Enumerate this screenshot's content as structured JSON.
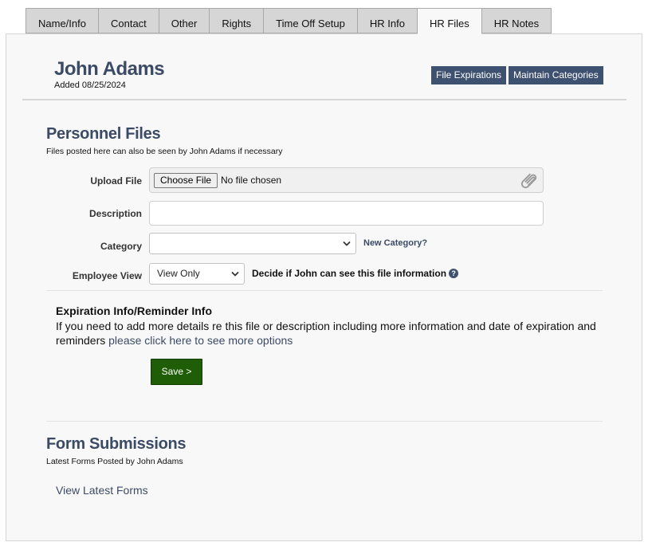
{
  "tabs": [
    {
      "label": "Name/Info"
    },
    {
      "label": "Contact"
    },
    {
      "label": "Other"
    },
    {
      "label": "Rights"
    },
    {
      "label": "Time Off Setup"
    },
    {
      "label": "HR Info"
    },
    {
      "label": "HR Files",
      "active": true
    },
    {
      "label": "HR Notes"
    }
  ],
  "employee": {
    "name": "John Adams",
    "added": "Added 08/25/2024"
  },
  "toolbar": {
    "file_expirations": "File Expirations",
    "maintain_categories": "Maintain Categories"
  },
  "personnel_files": {
    "title": "Personnel Files",
    "note": "Files posted here can also be seen by John Adams if necessary",
    "upload_label": "Upload File",
    "choose_file": "Choose File",
    "no_file": "No file chosen",
    "description_label": "Description",
    "description_value": "",
    "category_label": "Category",
    "category_value": "",
    "new_category": "New Category?",
    "employee_view_label": "Employee View",
    "employee_view_value": "View Only",
    "decide_text": "Decide if John can see this file information",
    "help_icon": "question-circle-icon"
  },
  "expiration": {
    "title": "Expiration Info/Reminder Info",
    "text": "If you need to add more details re this file or description including more information and date of expiration and reminders",
    "link": "please click here to see more options"
  },
  "save_label": "Save >",
  "form_submissions": {
    "title": "Form Submissions",
    "note": "Latest Forms Posted by John Adams",
    "link": "View Latest Forms"
  },
  "colors": {
    "accent": "#3f5170",
    "heading": "#3b4b66",
    "save": "#1f5e07"
  }
}
